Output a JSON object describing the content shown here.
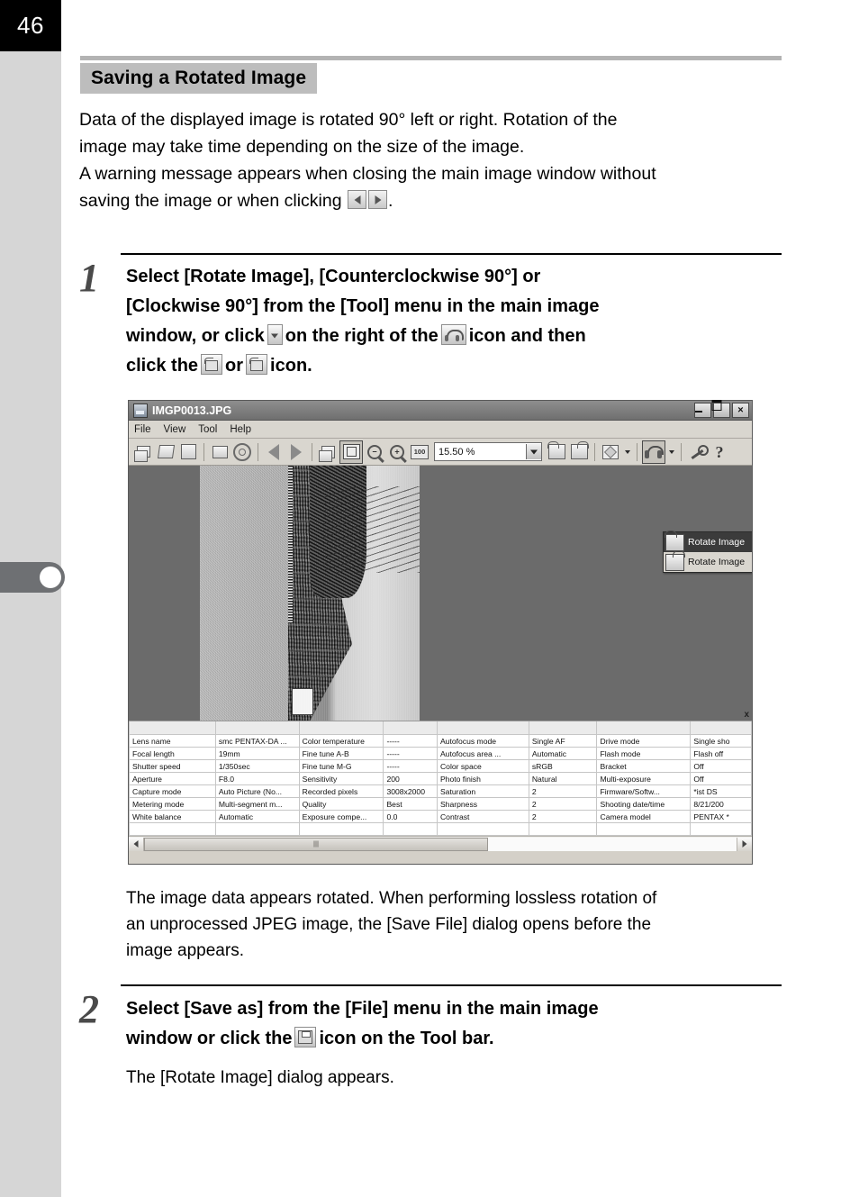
{
  "page": {
    "number": "46"
  },
  "heading": {
    "title": "Saving a Rotated Image"
  },
  "intro": {
    "line1": "Data of the displayed image is rotated 90° left or right. Rotation of the",
    "line2": "image may take time depending on the size of the image.",
    "line3": "A warning message appears when closing the main image window without",
    "line4_a": "saving the image or when clicking",
    "line4_b": "."
  },
  "step1": {
    "number": "1",
    "line1": "Select [Rotate Image], [Counterclockwise 90°] or",
    "line2": "[Clockwise 90°] from the [Tool] menu in the main image",
    "line3_a": "window, or click",
    "line3_b": "on the right of the",
    "line3_c": "icon and then",
    "line4_a": "click the",
    "line4_b": "or",
    "line4_c": "icon."
  },
  "step1_note": {
    "line1": "The image data appears rotated. When performing lossless rotation of",
    "line2": "an unprocessed JPEG image, the [Save File] dialog opens before the",
    "line3": "image appears."
  },
  "step2": {
    "number": "2",
    "line1": "Select [Save as] from the [File] menu in the main image",
    "line2_a": "window or click the",
    "line2_b": "icon on the Tool bar."
  },
  "step2_note": {
    "line1": "The [Rotate Image] dialog appears."
  },
  "app": {
    "title": "IMGP0013.JPG",
    "window_buttons": {
      "minimize": "minimize-button",
      "maximize": "maximize-button",
      "close": "×"
    },
    "menu": [
      "File",
      "View",
      "Tool",
      "Help"
    ],
    "toolbar": {
      "zoom_value": "15.50 %",
      "icons": [
        "new-window-icon",
        "open-folder-icon",
        "save-icon",
        "print-box-icon",
        "settings-gear-icon",
        "previous-image-icon",
        "next-image-icon",
        "browser-icon",
        "fit-to-window-icon",
        "zoom-out-icon",
        "zoom-in-icon",
        "actual-size-icon",
        "rotate-ccw-icon",
        "rotate-cw-icon",
        "effects-icon",
        "rotate-image-icon",
        "tools-icon",
        "help-icon"
      ]
    },
    "context_menu": {
      "items": [
        {
          "label": "Rotate Image",
          "icon": "rotate-ccw-icon",
          "selected": true
        },
        {
          "label": "Rotate Image",
          "icon": "rotate-cw-icon",
          "selected": false
        }
      ]
    },
    "metadata": [
      [
        "Lens name",
        "smc PENTAX-DA ...",
        "Color temperature",
        "-----",
        "Autofocus mode",
        "Single AF",
        "Drive mode",
        "Single sho"
      ],
      [
        "Focal length",
        "19mm",
        "Fine tune A-B",
        "-----",
        "Autofocus area ...",
        "Automatic",
        "Flash mode",
        "Flash off"
      ],
      [
        "Shutter speed",
        "1/350sec",
        "Fine tune M-G",
        "-----",
        "Color space",
        "sRGB",
        "Bracket",
        "Off"
      ],
      [
        "Aperture",
        "F8.0",
        "Sensitivity",
        "200",
        "Photo finish",
        "Natural",
        "Multi-exposure",
        "Off"
      ],
      [
        "Capture mode",
        "Auto Picture (No...",
        "Recorded pixels",
        "3008x2000",
        "Saturation",
        "2",
        "Firmware/Softw...",
        "*ist DS"
      ],
      [
        "Metering mode",
        "Multi-segment m...",
        "Quality",
        "Best",
        "Sharpness",
        "2",
        "Shooting date/time",
        "8/21/200"
      ],
      [
        "White balance",
        "Automatic",
        "Exposure compe...",
        "0.0",
        "Contrast",
        "2",
        "Camera model",
        "PENTAX *"
      ]
    ]
  }
}
